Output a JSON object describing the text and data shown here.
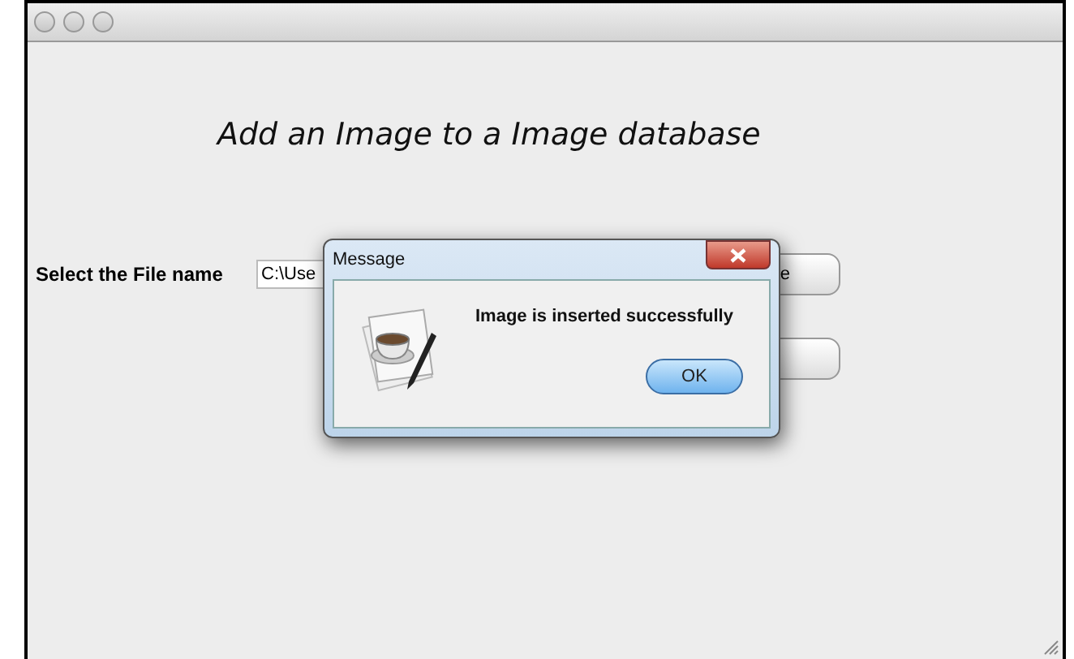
{
  "heading": "Add an Image to a Image database",
  "form": {
    "file_label": "Select the File name",
    "file_value": "C:\\Use",
    "browse_button": "e"
  },
  "dialog": {
    "title": "Message",
    "message": "Image is inserted successfully",
    "button": "OK"
  }
}
